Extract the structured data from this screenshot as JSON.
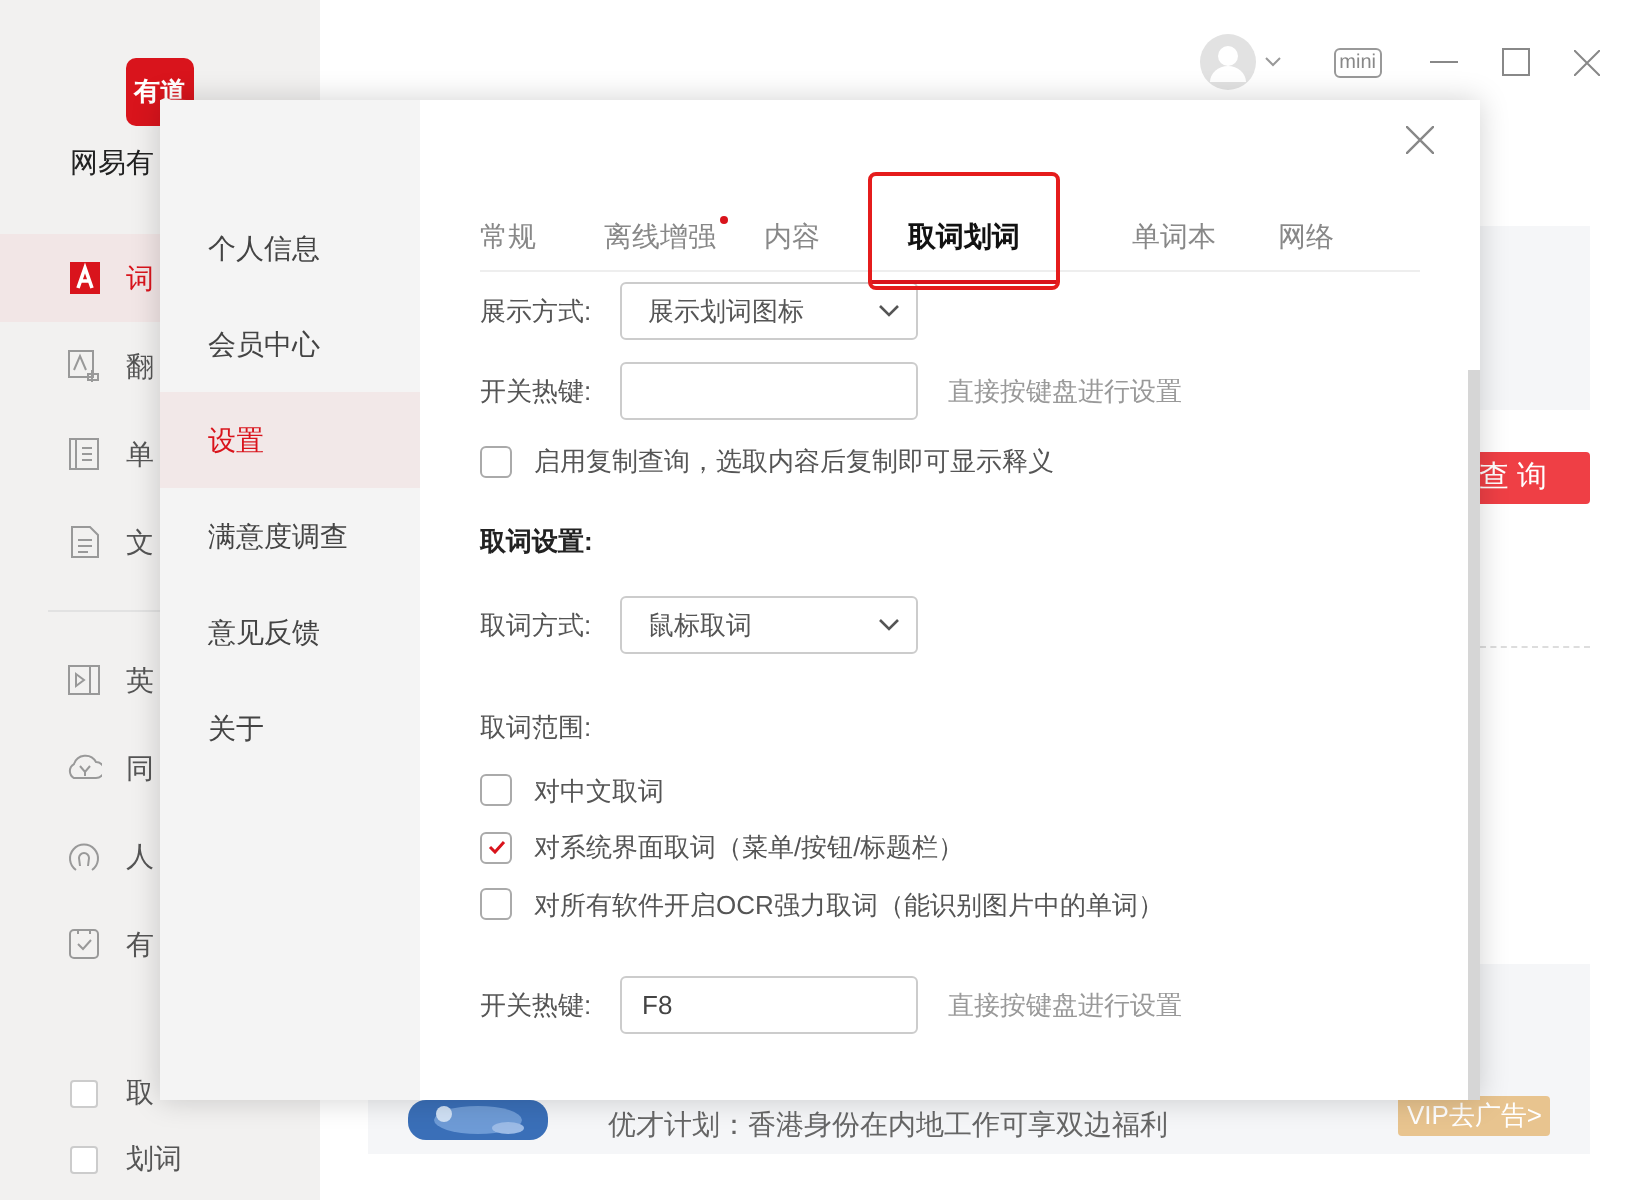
{
  "app": {
    "logo": "有道",
    "name": "网易有",
    "nav": [
      {
        "label": "词",
        "selected": true
      },
      {
        "label": "翻",
        "selected": false
      },
      {
        "label": "单",
        "selected": false
      },
      {
        "label": "文",
        "selected": false
      },
      {
        "label": "英",
        "selected": false
      },
      {
        "label": "同",
        "selected": false
      },
      {
        "label": "人",
        "selected": false
      },
      {
        "label": "有",
        "selected": false
      }
    ],
    "toggles": [
      {
        "label": "取",
        "checked": false
      },
      {
        "label": "划词",
        "checked": false
      }
    ],
    "mini": "mini",
    "search_button": "查 询",
    "banner": "优才计划：香港身份在内地工作可享双边福利",
    "vip_button": "VIP去广告>"
  },
  "dialog": {
    "menu": [
      {
        "label": "个人信息",
        "selected": false
      },
      {
        "label": "会员中心",
        "selected": false
      },
      {
        "label": "设置",
        "selected": true
      },
      {
        "label": "满意度调查",
        "selected": false
      },
      {
        "label": "意见反馈",
        "selected": false
      },
      {
        "label": "关于",
        "selected": false
      }
    ],
    "tabs": [
      {
        "label": "常规",
        "selected": false,
        "dot": false
      },
      {
        "label": "离线增强",
        "selected": false,
        "dot": true
      },
      {
        "label": "内容",
        "selected": false,
        "dot": false
      },
      {
        "label": "取词划词",
        "selected": true,
        "dot": false,
        "highlighted": true
      },
      {
        "label": "单词本",
        "selected": false,
        "dot": false
      },
      {
        "label": "网络",
        "selected": false,
        "dot": false
      }
    ],
    "rows": [
      {
        "kind": "select",
        "label": "展示方式:",
        "value": "展示划词图标"
      },
      {
        "kind": "hotkey",
        "label": "开关热键:",
        "value": "",
        "hint": "直接按键盘进行设置"
      },
      {
        "kind": "checkbox",
        "label": "启用复制查询，选取内容后复制即可显示释义",
        "checked": false
      },
      {
        "kind": "heading",
        "label": "取词设置:"
      },
      {
        "kind": "select",
        "label": "取词方式:",
        "value": "鼠标取词"
      },
      {
        "kind": "caption",
        "label": "取词范围:"
      },
      {
        "kind": "checkbox",
        "label": "对中文取词",
        "checked": false
      },
      {
        "kind": "checkbox",
        "label": "对系统界面取词（菜单/按钮/标题栏）",
        "checked": true
      },
      {
        "kind": "checkbox",
        "label": "对所有软件开启OCR强力取词（能识别图片中的单词）",
        "checked": false
      },
      {
        "kind": "hotkey",
        "label": "开关热键:",
        "value": "F8",
        "hint": "直接按键盘进行设置"
      }
    ]
  }
}
